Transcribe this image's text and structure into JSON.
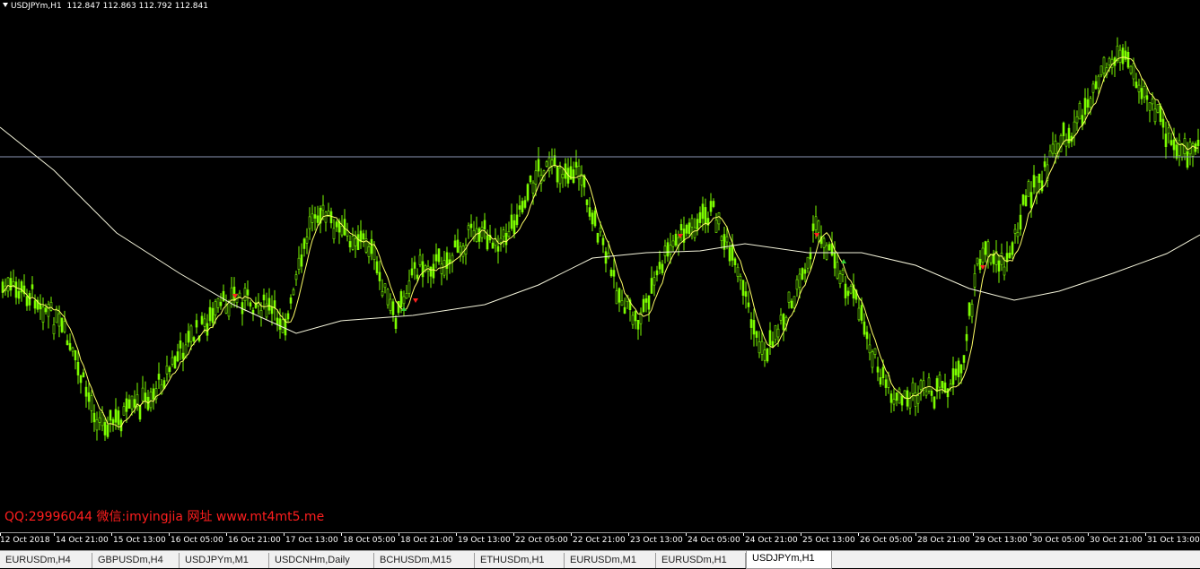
{
  "header": {
    "symbol": "USDJPYm,H1",
    "open": "112.847",
    "high": "112.863",
    "low": "112.792",
    "close": "112.841"
  },
  "watermark": "QQ:29996044 微信:imyingjia 网址 www.mt4mt5.me",
  "time_axis": {
    "labels": [
      "12 Oct 2018",
      "14 Oct 21:00",
      "15 Oct 13:00",
      "16 Oct 05:00",
      "16 Oct 21:00",
      "17 Oct 13:00",
      "18 Oct 05:00",
      "18 Oct 21:00",
      "19 Oct 13:00",
      "22 Oct 05:00",
      "22 Oct 21:00",
      "23 Oct 13:00",
      "24 Oct 05:00",
      "24 Oct 21:00",
      "25 Oct 13:00",
      "26 Oct 05:00",
      "28 Oct 21:00",
      "29 Oct 13:00",
      "30 Oct 05:00",
      "30 Oct 21:00",
      "31 Oct 13:00"
    ]
  },
  "tabs": [
    {
      "label": "EURUSDm,H4",
      "active": false
    },
    {
      "label": "GBPUSDm,H4",
      "active": false
    },
    {
      "label": "USDJPYm,M1",
      "active": false
    },
    {
      "label": "USDCNHm,Daily",
      "active": false
    },
    {
      "label": "BCHUSDm,M15",
      "active": false
    },
    {
      "label": "ETHUSDm,H1",
      "active": false
    },
    {
      "label": "EURUSDm,M1",
      "active": false
    },
    {
      "label": "EURUSDm,H1",
      "active": false
    },
    {
      "label": "USDJPYm,H1",
      "active": true
    }
  ],
  "colors": {
    "background": "#000000",
    "candles": "#7CFC00",
    "fast_ma": "#FFFF66",
    "slow_ma": "#F5F5DC",
    "price_line": "#8C96B4",
    "sell_arrow": "#FF2020",
    "buy_arrow": "#32CD32",
    "watermark": "#FF1E1E"
  },
  "chart_data": {
    "type": "candlestick",
    "current_price_line": 112.841,
    "signals": [
      {
        "type": "sell",
        "time": "16 Oct 21:00"
      },
      {
        "type": "buy",
        "time": "18 Oct 13:00"
      },
      {
        "type": "sell",
        "time": "18 Oct 21:00"
      },
      {
        "type": "sell",
        "time": "23 Oct 21:00"
      },
      {
        "type": "sell",
        "time": "25 Oct 13:00"
      },
      {
        "type": "buy",
        "time": "25 Oct 21:00"
      },
      {
        "type": "sell",
        "time": "29 Oct 05:00"
      }
    ]
  }
}
